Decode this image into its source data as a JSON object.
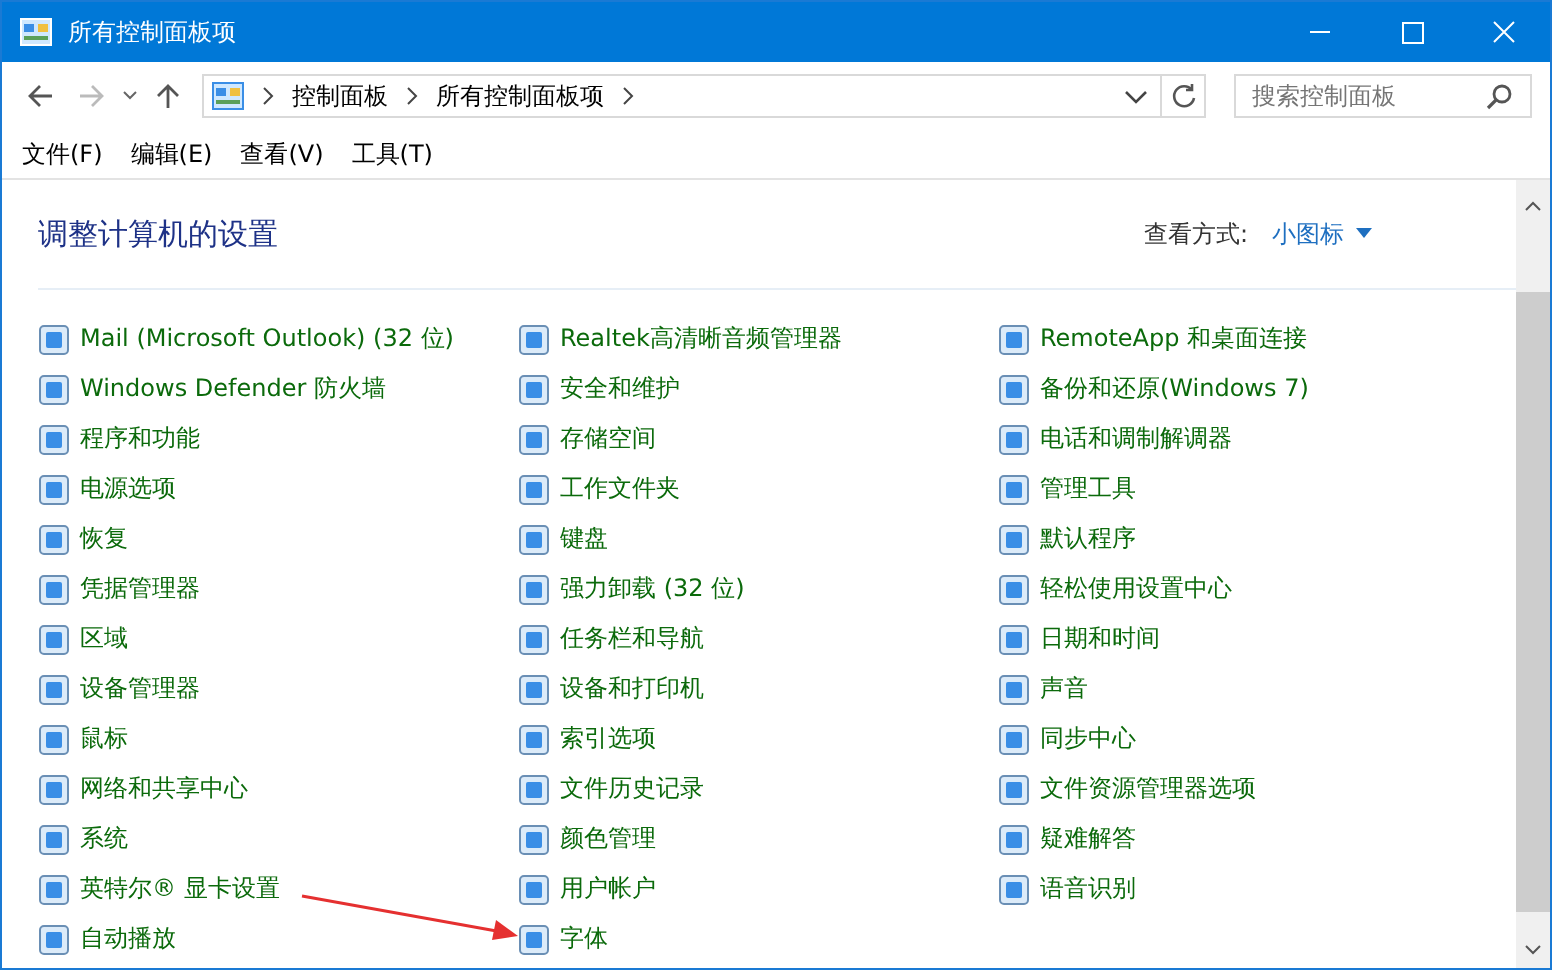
{
  "window": {
    "title": "所有控制面板项"
  },
  "address_bar": {
    "crumbs": [
      "控制面板",
      "所有控制面板项"
    ]
  },
  "search": {
    "placeholder": "搜索控制面板"
  },
  "menu": [
    "文件(F)",
    "编辑(E)",
    "查看(V)",
    "工具(T)"
  ],
  "header": {
    "title": "调整计算机的设置",
    "view_label": "查看方式:",
    "view_value": "小图标"
  },
  "columns": [
    [
      "Mail (Microsoft Outlook) (32 位)",
      "Windows Defender 防火墙",
      "程序和功能",
      "电源选项",
      "恢复",
      "凭据管理器",
      "区域",
      "设备管理器",
      "鼠标",
      "网络和共享中心",
      "系统",
      "英特尔® 显卡设置",
      "自动播放"
    ],
    [
      "Realtek高清晰音频管理器",
      "安全和维护",
      "存储空间",
      "工作文件夹",
      "键盘",
      "强力卸载 (32 位)",
      "任务栏和导航",
      "设备和打印机",
      "索引选项",
      "文件历史记录",
      "颜色管理",
      "用户帐户",
      "字体"
    ],
    [
      "RemoteApp 和桌面连接",
      "备份和还原(Windows 7)",
      "电话和调制解调器",
      "管理工具",
      "默认程序",
      "轻松使用设置中心",
      "日期和时间",
      "声音",
      "同步中心",
      "文件资源管理器选项",
      "疑难解答",
      "语音识别"
    ]
  ]
}
